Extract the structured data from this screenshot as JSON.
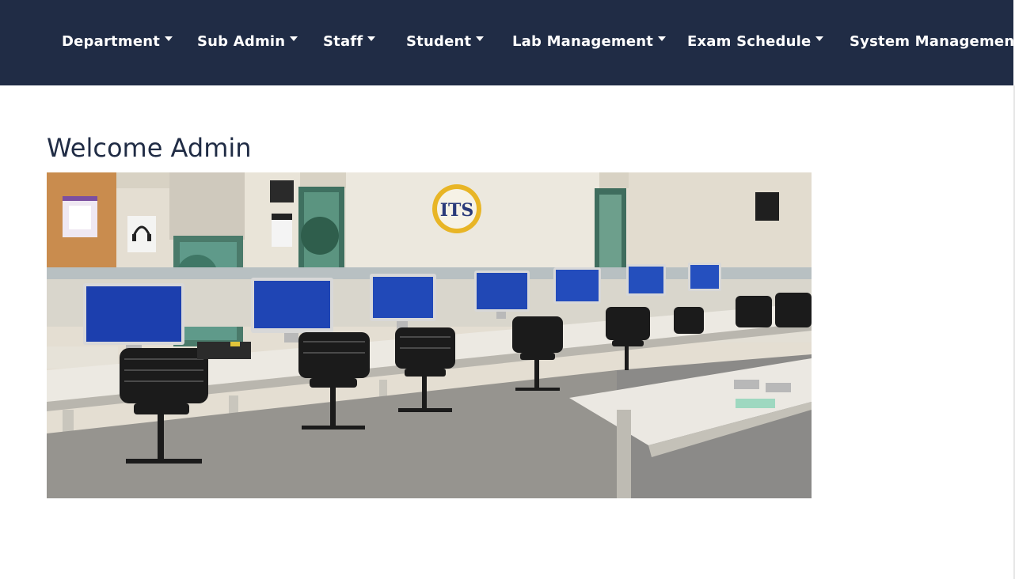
{
  "nav": {
    "items": [
      {
        "label": "Department"
      },
      {
        "label": "Sub Admin"
      },
      {
        "label": "Staff"
      },
      {
        "label": "Student"
      },
      {
        "label": "Lab Management"
      },
      {
        "label": "Exam Schedule"
      },
      {
        "label": "System Management"
      }
    ]
  },
  "main": {
    "heading": "Welcome Admin",
    "photo": {
      "subject": "computer-lab",
      "logo_text": "ITS"
    }
  },
  "colors": {
    "navbar_bg": "#202c45",
    "heading": "#202c45",
    "nav_text": "#ffffff"
  }
}
